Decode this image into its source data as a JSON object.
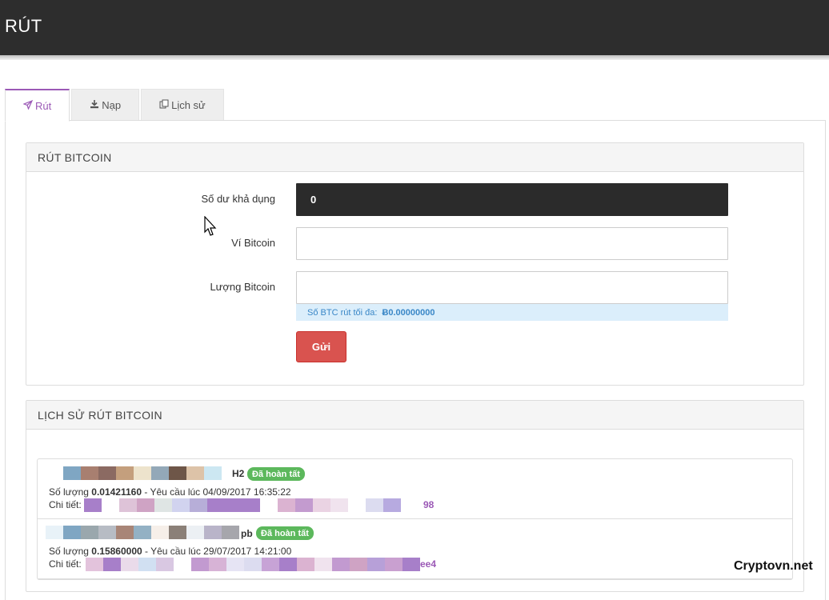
{
  "header": {
    "title": "RÚT"
  },
  "tabs": [
    {
      "label": "Rút",
      "icon": "send-icon"
    },
    {
      "label": "Nạp",
      "icon": "download-icon"
    },
    {
      "label": "Lịch sử",
      "icon": "copy-icon"
    }
  ],
  "withdraw": {
    "title": "RÚT BITCOIN",
    "balance_label": "Số dư khả dụng",
    "balance_value": "0",
    "wallet_label": "Ví Bitcoin",
    "wallet_value": "",
    "amount_label": "Lượng Bitcoin",
    "amount_value": "",
    "max_label": "Số BTC rút tối đa:",
    "max_value": "Ƀ0.00000000",
    "submit_label": "Gửi"
  },
  "history": {
    "title": "LỊCH SỬ RÚT BITCOIN",
    "items": [
      {
        "code_suffix": "H2",
        "status": "Đã hoàn tất",
        "amount_prefix": "Số lượng ",
        "amount": "0.01421160",
        "time_text": " - Yêu cầu lúc 04/09/2017 16:35:22",
        "detail_label": "Chi tiết:",
        "detail_suffix": "98"
      },
      {
        "code_suffix": "pb",
        "status": "Đã hoàn tất",
        "amount_prefix": "Số lượng ",
        "amount": "0.15860000",
        "time_text": " - Yêu cầu lúc 29/07/2017 14:21:00",
        "detail_label": "Chi tiết:",
        "detail_suffix": "ee4"
      }
    ]
  },
  "watermark": "Cryptovn.net",
  "colors": {
    "accent": "#9b59b6",
    "danger": "#d9534f",
    "success": "#5cb85c",
    "header_bg": "#2d2d2d"
  }
}
